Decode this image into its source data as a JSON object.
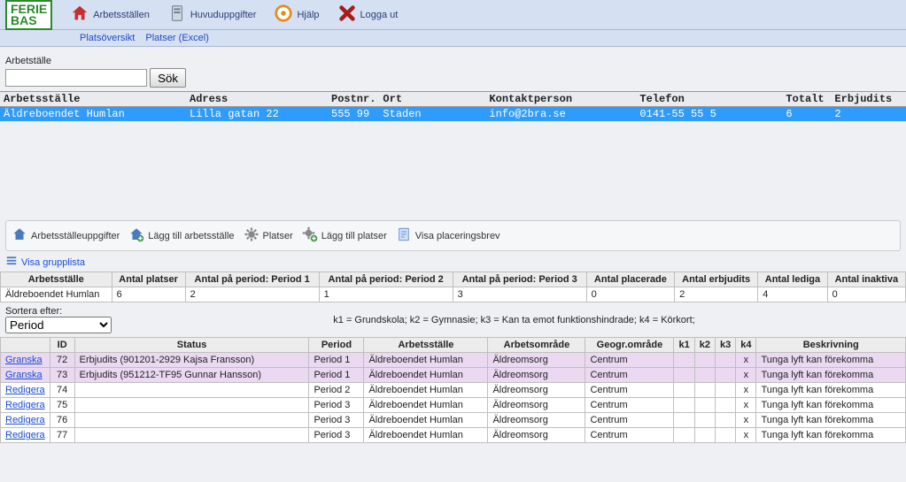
{
  "logo": {
    "line1": "FERIE",
    "line2": "BAS"
  },
  "topnav": {
    "work": "Arbetsställen",
    "main": "Huvuduppgifter",
    "help": "Hjälp",
    "logout": "Logga ut"
  },
  "subnav": {
    "a": "Platsöversikt",
    "b": "Platser (Excel)"
  },
  "search": {
    "label": "Arbetställe",
    "value": "",
    "btn": "Sök"
  },
  "wp_headers": {
    "name": "Arbetsställe",
    "addr": "Adress",
    "post": "Postnr.",
    "city": "Ort",
    "contact": "Kontaktperson",
    "phone": "Telefon",
    "total": "Totalt",
    "off": "Erbjudits"
  },
  "wp_row": {
    "name": "Äldreboendet Humlan",
    "addr": "Lilla gatan 22",
    "post": "555 99",
    "city": "Staden",
    "contact": "info@2bra.se",
    "phone": "0141-55 55 5",
    "total": "6",
    "off": "2"
  },
  "tools": {
    "info": "Arbetsställeuppgifter",
    "add": "Lägg till arbetsställe",
    "platser": "Platser",
    "addpl": "Lägg till platser",
    "showletter": "Visa placeringsbrev"
  },
  "grouplink": "Visa grupplista",
  "summary_h": {
    "c1": "Arbetsställe",
    "c2": "Antal platser",
    "c3": "Antal på period: Period 1",
    "c4": "Antal på period: Period 2",
    "c5": "Antal på period: Period 3",
    "c6": "Antal placerade",
    "c7": "Antal erbjudits",
    "c8": "Antal lediga",
    "c9": "Antal inaktiva"
  },
  "summary_r": {
    "c1": "Äldreboendet Humlan",
    "c2": "6",
    "c3": "2",
    "c4": "1",
    "c5": "3",
    "c6": "0",
    "c7": "2",
    "c8": "4",
    "c9": "0"
  },
  "sort": {
    "label": "Sortera efter:",
    "value": "Period"
  },
  "legend": "k1 = Grundskola; k2 = Gymnasie; k3 = Kan ta emot funktionshindrade; k4 = Körkort;",
  "detail_h": {
    "action": "",
    "id": "ID",
    "status": "Status",
    "period": "Period",
    "place": "Arbetsställe",
    "area": "Arbetsområde",
    "geo": "Geogr.område",
    "k1": "k1",
    "k2": "k2",
    "k3": "k3",
    "k4": "k4",
    "descr": "Beskrivning"
  },
  "detail_rows": [
    {
      "action": "Granska",
      "id": "72",
      "status": "Erbjudits (901201-2929 Kajsa Fransson)",
      "period": "Period 1",
      "place": "Äldreboendet Humlan",
      "area": "Äldreomsorg",
      "geo": "Centrum",
      "k1": "",
      "k2": "",
      "k3": "",
      "k4": "x",
      "descr": "Tunga lyft kan förekomma",
      "hl": true
    },
    {
      "action": "Granska",
      "id": "73",
      "status": "Erbjudits (951212-TF95 Gunnar Hansson)",
      "period": "Period 1",
      "place": "Äldreboendet Humlan",
      "area": "Äldreomsorg",
      "geo": "Centrum",
      "k1": "",
      "k2": "",
      "k3": "",
      "k4": "x",
      "descr": "Tunga lyft kan förekomma",
      "hl": true
    },
    {
      "action": "Redigera",
      "id": "74",
      "status": "",
      "period": "Period 2",
      "place": "Äldreboendet Humlan",
      "area": "Äldreomsorg",
      "geo": "Centrum",
      "k1": "",
      "k2": "",
      "k3": "",
      "k4": "x",
      "descr": "Tunga lyft kan förekomma",
      "hl": false
    },
    {
      "action": "Redigera",
      "id": "75",
      "status": "",
      "period": "Period 3",
      "place": "Äldreboendet Humlan",
      "area": "Äldreomsorg",
      "geo": "Centrum",
      "k1": "",
      "k2": "",
      "k3": "",
      "k4": "x",
      "descr": "Tunga lyft kan förekomma",
      "hl": false
    },
    {
      "action": "Redigera",
      "id": "76",
      "status": "",
      "period": "Period 3",
      "place": "Äldreboendet Humlan",
      "area": "Äldreomsorg",
      "geo": "Centrum",
      "k1": "",
      "k2": "",
      "k3": "",
      "k4": "x",
      "descr": "Tunga lyft kan förekomma",
      "hl": false
    },
    {
      "action": "Redigera",
      "id": "77",
      "status": "",
      "period": "Period 3",
      "place": "Äldreboendet Humlan",
      "area": "Äldreomsorg",
      "geo": "Centrum",
      "k1": "",
      "k2": "",
      "k3": "",
      "k4": "x",
      "descr": "Tunga lyft kan förekomma",
      "hl": false
    }
  ]
}
